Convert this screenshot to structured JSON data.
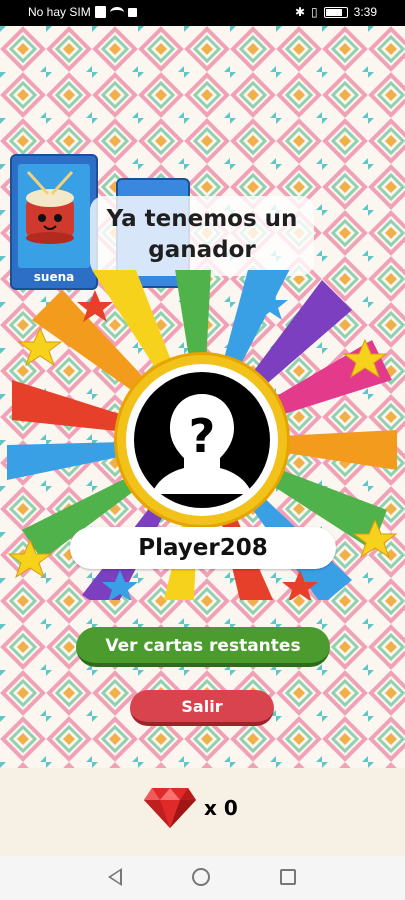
{
  "status_bar": {
    "carrier": "No hay SIM",
    "time": "3:39"
  },
  "cards": [
    {
      "label": "suena",
      "icon": "drum-icon"
    },
    {
      "label": "",
      "icon": "card-icon"
    }
  ],
  "winner": {
    "headline": "Ya tenemos un ganador",
    "player_name": "Player208"
  },
  "actions": {
    "view_remaining_label": "Ver cartas restantes",
    "exit_label": "Salir"
  },
  "currency": {
    "icon": "diamond-icon",
    "count_text": "x 0"
  },
  "nav_bar": {
    "back": "back-icon",
    "home": "home-icon",
    "recent": "recent-apps-icon"
  },
  "colors": {
    "accent_green": "#4b9b2e",
    "accent_red": "#d8434d",
    "gem_red": "#e02a2a"
  }
}
